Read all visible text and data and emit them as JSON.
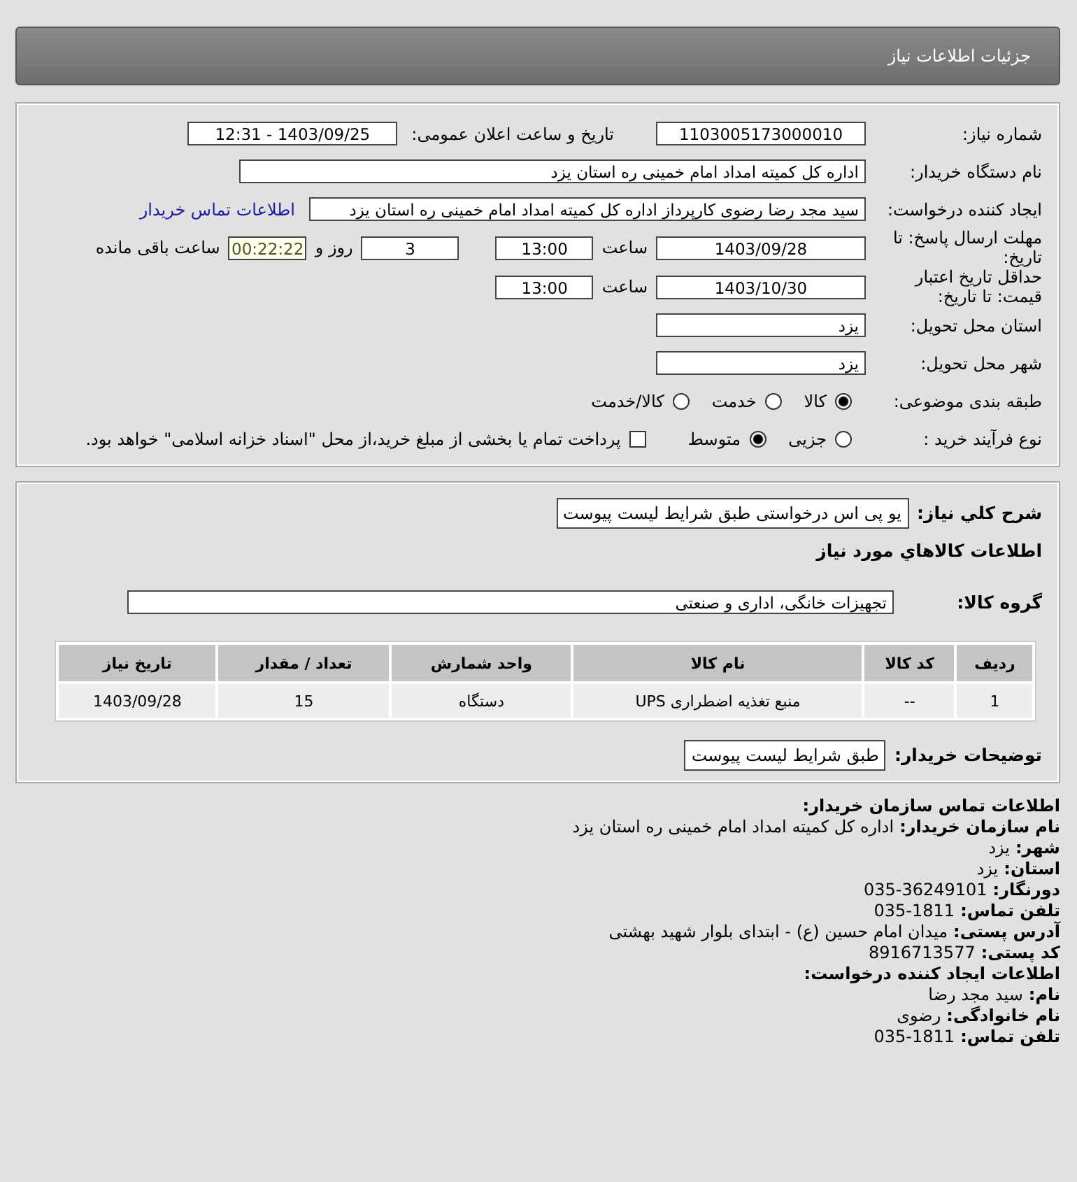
{
  "header": {
    "title": "جزئیات اطلاعات نیاز"
  },
  "form": {
    "need_number": {
      "label": "شماره نیاز:",
      "value": "1103005173000010"
    },
    "announce": {
      "label": "تاریخ و ساعت اعلان عمومی:",
      "value": "1403/09/25 - 12:31"
    },
    "buyer_org": {
      "label": "نام دستگاه خریدار:",
      "value": "اداره کل کمیته امداد امام خمینی  ره  استان یزد"
    },
    "requester": {
      "label": "ایجاد کننده درخواست:",
      "value": "سید مجد رضا رضوی کارپرداز اداره کل کمیته امداد امام خمینی  ره  استان یزد",
      "link": "اطلاعات تماس خریدار"
    },
    "deadline": {
      "label": "مهلت ارسال پاسخ: تا تاریخ:",
      "date": "1403/09/28",
      "time_label": "ساعت",
      "time": "13:00",
      "days": "3",
      "days_label": "روز و",
      "remaining": "00:22:22",
      "remaining_label": "ساعت باقی مانده"
    },
    "validity": {
      "label": "حداقل تاریخ اعتبار قیمت: تا تاریخ:",
      "date": "1403/10/30",
      "time_label": "ساعت",
      "time": "13:00"
    },
    "province": {
      "label": "استان محل تحویل:",
      "value": "یزد"
    },
    "city": {
      "label": "شهر محل تحویل:",
      "value": "یزد"
    },
    "category": {
      "label": "طبقه بندی موضوعی:",
      "options": [
        {
          "label": "کالا",
          "selected": true
        },
        {
          "label": "خدمت",
          "selected": false
        },
        {
          "label": "کالا/خدمت",
          "selected": false
        }
      ]
    },
    "process": {
      "label": "نوع فرآیند خرید :",
      "options": [
        {
          "label": "جزیی",
          "selected": false
        },
        {
          "label": "متوسط",
          "selected": true
        }
      ],
      "payment": {
        "label": "پرداخت تمام یا بخشی از مبلغ خرید،از محل \"اسناد خزانه اسلامی\" خواهد بود.",
        "checked": false
      }
    }
  },
  "details": {
    "summary": {
      "label": "شرح کلي نياز:",
      "value": "یو پی اس درخواستی طبق شرایط لیست پیوست"
    },
    "goods_title": "اطلاعات کالاهاي مورد نياز",
    "group": {
      "label": "گروه کالا:",
      "value": "تجهیزات خانگی، اداری و صنعتی"
    },
    "table": {
      "columns": [
        "ردیف",
        "کد کالا",
        "نام کالا",
        "واحد شمارش",
        "تعداد / مقدار",
        "تاریخ نیاز"
      ],
      "rows": [
        [
          "1",
          "--",
          "منبع تغذیه اضطراری UPS",
          "دستگاه",
          "15",
          "1403/09/28"
        ]
      ]
    },
    "notes": {
      "label": "توضیحات خریدار:",
      "value": "طبق شرایط لیست پیوست"
    }
  },
  "contact": [
    {
      "kind": "heading",
      "label": "اطلاعات تماس سازمان خریدار:"
    },
    {
      "kind": "field",
      "label": "نام سازمان خریدار:",
      "value": "اداره کل کمیته امداد امام خمینی ره استان یزد"
    },
    {
      "kind": "field",
      "label": "شهر:",
      "value": "یزد"
    },
    {
      "kind": "field",
      "label": "استان:",
      "value": "یزد"
    },
    {
      "kind": "field",
      "label": "دورنگار:",
      "value": "035-36249101"
    },
    {
      "kind": "field",
      "label": "تلفن تماس:",
      "value": "035-1811"
    },
    {
      "kind": "field",
      "label": "آدرس پستی:",
      "value": "میدان امام حسین (ع) - ابتدای بلوار شهید بهشتی"
    },
    {
      "kind": "field",
      "label": "کد پستی:",
      "value": "8916713577"
    },
    {
      "kind": "heading",
      "label": "اطلاعات ایجاد کننده درخواست:"
    },
    {
      "kind": "field",
      "label": "نام:",
      "value": "سید مجد رضا"
    },
    {
      "kind": "field",
      "label": "نام خانوادگی:",
      "value": "رضوی"
    },
    {
      "kind": "field",
      "label": "تلفن تماس:",
      "value": "035-1811"
    }
  ]
}
